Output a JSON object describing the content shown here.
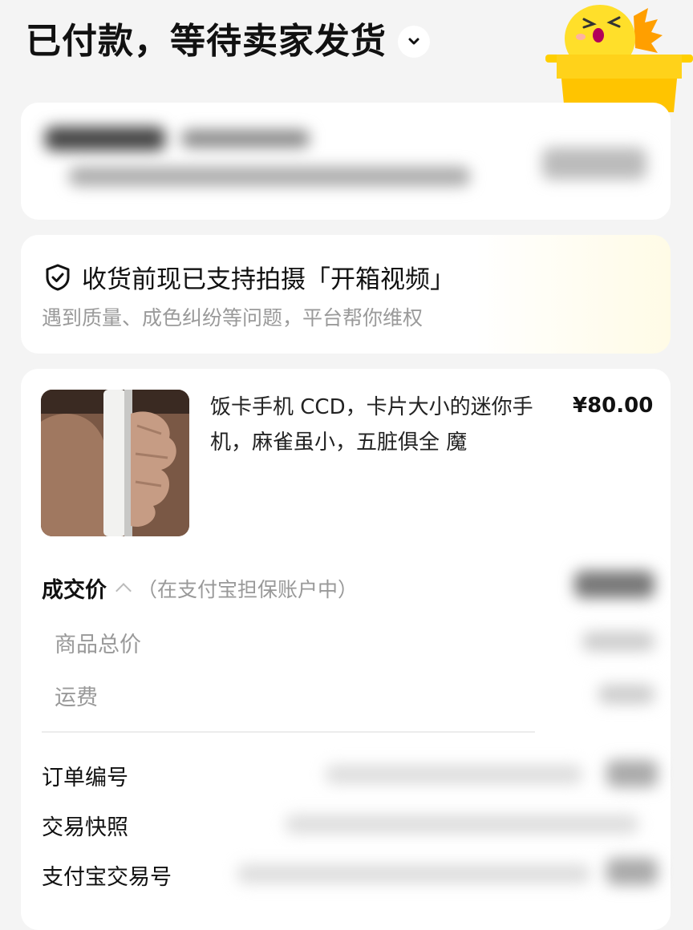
{
  "header": {
    "title": "已付款，等待卖家发货"
  },
  "promo": {
    "title": "收货前现已支持拍摄「开箱视频」",
    "subtitle": "遇到质量、成色纠纷等问题，平台帮你维权"
  },
  "product": {
    "name": "饭卡手机 CCD，卡片大小的迷你手机，麻雀虽小，五脏俱全 魔",
    "price": "¥80.00"
  },
  "price_section": {
    "label": "成交价",
    "note": "（在支付宝担保账户中）",
    "items": [
      "商品总价",
      "运费"
    ]
  },
  "order_info": {
    "order_number_label": "订单编号",
    "snapshot_label": "交易快照",
    "alipay_label": "支付宝交易号"
  },
  "colors": {
    "accent": "#ffd800",
    "text": "#111111",
    "muted": "#9a9a9a",
    "background": "#f4f4f4"
  }
}
